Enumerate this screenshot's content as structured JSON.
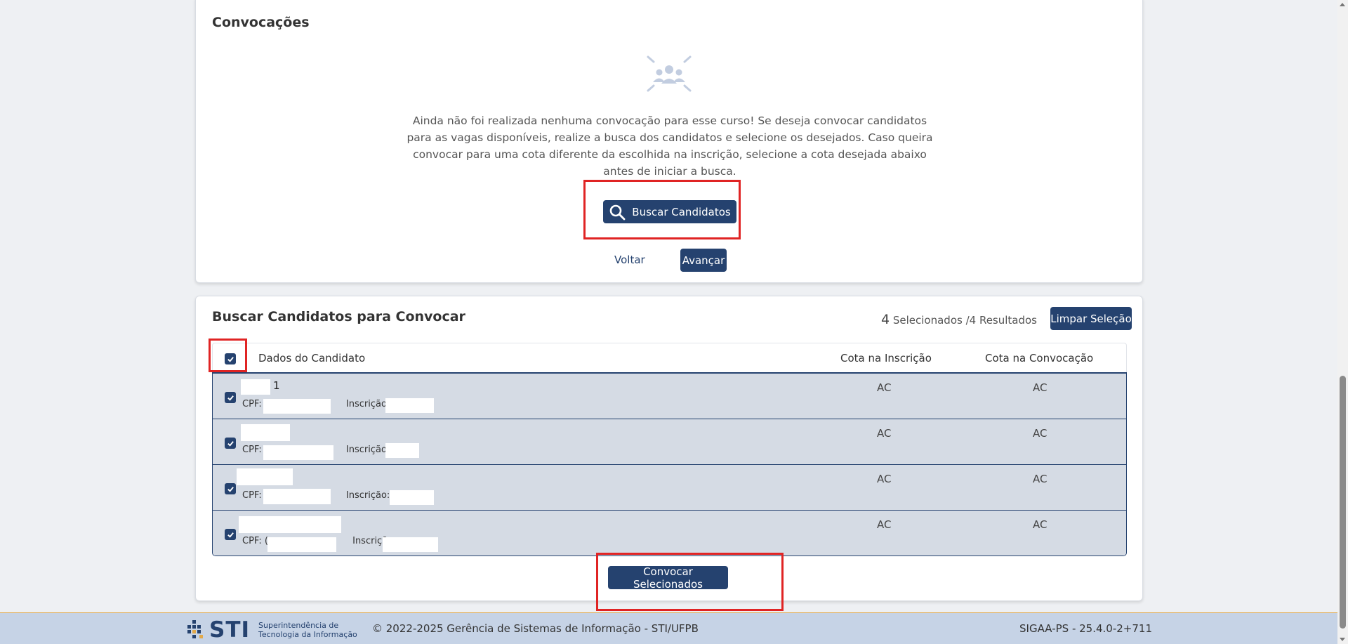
{
  "convocacoes": {
    "title": "Convocações",
    "empty_message": "Ainda não foi realizada nenhuma convocação para esse curso! Se deseja convocar candidatos para as vagas disponíveis, realize a busca dos candidatos e selecione os desejados. Caso queira convocar para uma cota diferente da escolhida na inscrição, selecione a cota desejada abaixo antes de iniciar a busca.",
    "buscar_label": "Buscar Candidatos",
    "voltar_label": "Voltar",
    "avancar_label": "Avançar",
    "icon": "users-group-icon"
  },
  "busca": {
    "title": "Buscar Candidatos para Convocar",
    "selected_count": "4",
    "selected_text": " Selecionados /4 Resultados",
    "limpar_label": "Limpar Seleção",
    "convocar_label": "Convocar Selecionados",
    "columns": {
      "dados": "Dados do Candidato",
      "cota_inscricao": "Cota na Inscrição",
      "cota_convocacao": "Cota na Convocação"
    },
    "rows": [
      {
        "name_suffix": "1",
        "cpf_label": "CPF:",
        "inscricao_label": "Inscrição:",
        "cota_inscricao": "AC",
        "cota_convocacao": "AC"
      },
      {
        "name_suffix": "",
        "cpf_label": "CPF:",
        "inscricao_label": "Inscrição:",
        "cota_inscricao": "AC",
        "cota_convocacao": "AC"
      },
      {
        "name_suffix": "",
        "cpf_label": "CPF:",
        "inscricao_label": "Inscrição: 1",
        "cota_inscricao": "AC",
        "cota_convocacao": "AC"
      },
      {
        "name_suffix": "",
        "cpf_label": "CPF: (",
        "inscricao_label": "Inscrição:",
        "cota_inscricao": "AC",
        "cota_convocacao": "AC"
      }
    ]
  },
  "footer": {
    "logo_text": "STI",
    "logo_sub_1": "Superintendência de",
    "logo_sub_2": "Tecnologia da Informação",
    "copyright": "© 2022-2025 Gerência de Sistemas de Informação - STI/UFPB",
    "version": "SIGAA-PS - 25.4.0-2+711"
  },
  "colors": {
    "primary": "#25426f",
    "row_bg": "#d5dbe4",
    "highlight": "#e02424",
    "footer_bg": "#c6d3e6"
  }
}
